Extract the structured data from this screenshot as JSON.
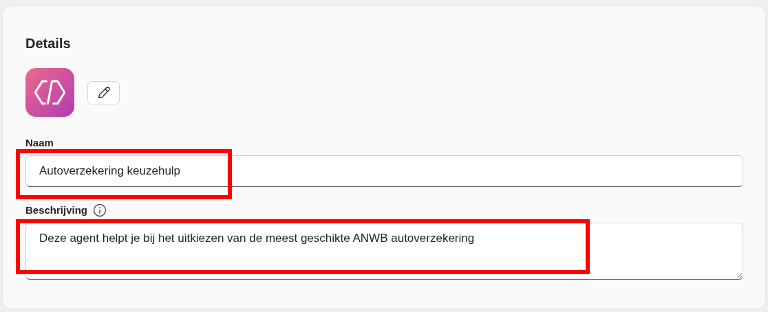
{
  "section": {
    "title": "Details"
  },
  "avatar": {
    "kind": "code-icon"
  },
  "edit_button": {
    "kind": "pencil"
  },
  "fields": [
    {
      "kind": "input",
      "label": "Naam",
      "info": false,
      "value": "Autoverzekering keuzehulp",
      "highlighted": true
    },
    {
      "kind": "textarea",
      "label": "Beschrijving",
      "info": true,
      "value": "Deze agent helpt je bij het uitkiezen van de meest geschikte ANWB autoverzekering",
      "highlighted": true
    }
  ]
}
